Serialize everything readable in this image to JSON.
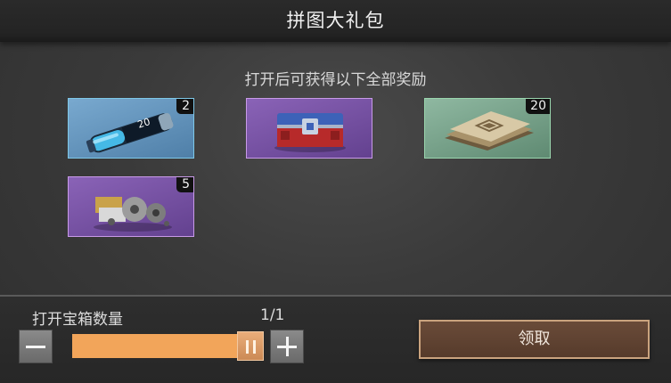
{
  "header": {
    "title": "拼图大礼包"
  },
  "rewards": {
    "subtitle": "打开后可获得以下全部奖励",
    "items": [
      {
        "icon": "blue-capsule-icon",
        "rarity": "blue",
        "count": "2",
        "capsule_text": "20"
      },
      {
        "icon": "red-blue-chest-icon",
        "rarity": "purple",
        "count": ""
      },
      {
        "icon": "document-stack-icon",
        "rarity": "green",
        "count": "20"
      },
      {
        "icon": "gears-parts-icon",
        "rarity": "purple",
        "count": "5"
      }
    ]
  },
  "footer": {
    "qty_label": "打开宝箱数量",
    "qty_value": "1/1",
    "slider_fraction": 1,
    "claim_label": "领取"
  },
  "colors": {
    "accent_orange": "#f2a55a",
    "blue_border": "#7ec8e8",
    "purple_border": "#c89ae8",
    "green_border": "#9ad6ae",
    "claim_button": "#5f4332"
  }
}
